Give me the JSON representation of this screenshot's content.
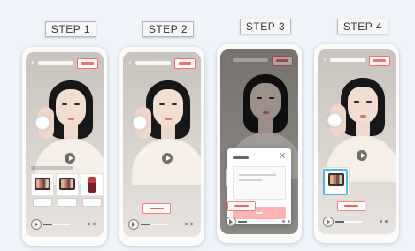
{
  "steps": [
    {
      "label": "STEP 1"
    },
    {
      "label": "STEP 2"
    },
    {
      "label": "STEP 3"
    },
    {
      "label": "STEP 4"
    }
  ],
  "icons": {
    "back": "chevron-left-icon",
    "play": "play-icon",
    "close": "close-icon",
    "more": "more-icon"
  },
  "colors": {
    "accent": "#ff6b6b",
    "modal_cta": "#ffb3b3",
    "highlight": "#4db6e8"
  },
  "modal": {
    "close_label": "×"
  }
}
